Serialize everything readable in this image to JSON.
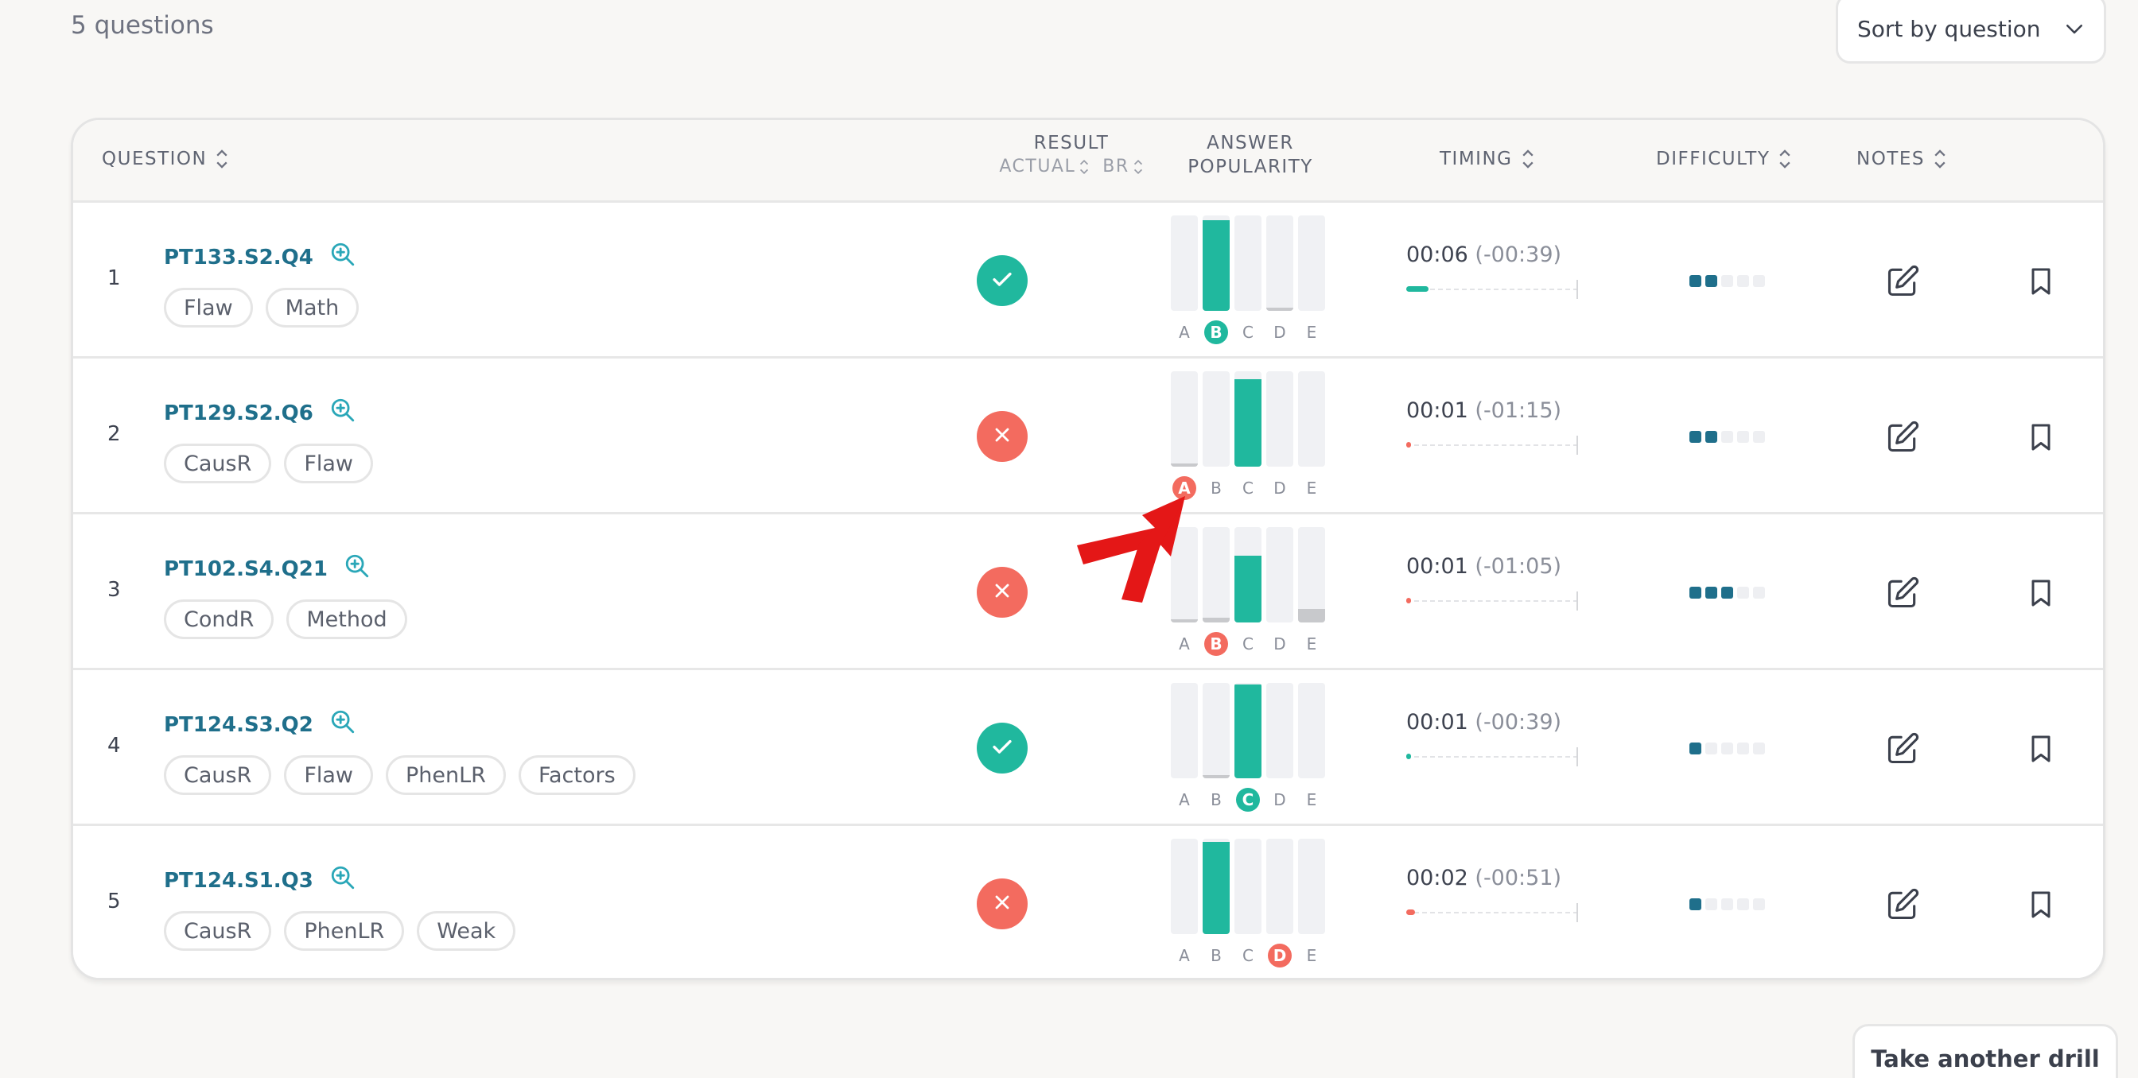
{
  "header": {
    "count_text": "5 questions",
    "sort_label": "Sort by question"
  },
  "columns": {
    "question": "QUESTION",
    "result": "RESULT",
    "actual": "ACTUAL",
    "br": "BR",
    "popularity_1": "ANSWER",
    "popularity_2": "POPULARITY",
    "timing": "TIMING",
    "difficulty": "DIFFICULTY",
    "notes": "NOTES"
  },
  "letters": [
    "A",
    "B",
    "C",
    "D",
    "E"
  ],
  "colors": {
    "correct": "#20b89e",
    "incorrect": "#f36b5f",
    "accent": "#1f6f8b",
    "neutral_fill": "#c8c9cc"
  },
  "rows": [
    {
      "num": "1",
      "id": "PT133.S2.Q4",
      "tags": [
        "Flaw",
        "Math"
      ],
      "result": "correct",
      "selected": "B",
      "selected_state": "correct",
      "popularity": [
        0,
        0.95,
        0,
        0.03,
        0
      ],
      "popular_correct": "B",
      "time": "00:06",
      "delta": "(-00:39)",
      "time_fraction": 0.13,
      "time_state": "ok",
      "difficulty": 2
    },
    {
      "num": "2",
      "id": "PT129.S2.Q6",
      "tags": [
        "CausR",
        "Flaw"
      ],
      "result": "incorrect",
      "selected": "A",
      "selected_state": "incorrect",
      "popularity": [
        0.03,
        0,
        0.92,
        0,
        0
      ],
      "popular_correct": "C",
      "time": "00:01",
      "delta": "(-01:15)",
      "time_fraction": 0.02,
      "time_state": "bad",
      "difficulty": 2
    },
    {
      "num": "3",
      "id": "PT102.S4.Q21",
      "tags": [
        "CondR",
        "Method"
      ],
      "result": "incorrect",
      "selected": "B",
      "selected_state": "incorrect",
      "popularity": [
        0.03,
        0.05,
        0.7,
        0,
        0.14
      ],
      "popular_correct": "C",
      "time": "00:01",
      "delta": "(-01:05)",
      "time_fraction": 0.02,
      "time_state": "bad",
      "difficulty": 3
    },
    {
      "num": "4",
      "id": "PT124.S3.Q2",
      "tags": [
        "CausR",
        "Flaw",
        "PhenLR",
        "Factors"
      ],
      "result": "correct",
      "selected": "C",
      "selected_state": "correct",
      "popularity": [
        0,
        0.02,
        0.98,
        0,
        0
      ],
      "popular_correct": "C",
      "time": "00:01",
      "delta": "(-00:39)",
      "time_fraction": 0.02,
      "time_state": "ok",
      "difficulty": 1
    },
    {
      "num": "5",
      "id": "PT124.S1.Q3",
      "tags": [
        "CausR",
        "PhenLR",
        "Weak"
      ],
      "result": "incorrect",
      "selected": "D",
      "selected_state": "incorrect",
      "popularity": [
        0,
        0.97,
        0,
        0,
        0
      ],
      "popular_correct": "B",
      "time": "00:02",
      "delta": "(-00:51)",
      "time_fraction": 0.05,
      "time_state": "bad",
      "difficulty": 1
    }
  ],
  "footer": {
    "take_drill_label": "Take another drill"
  }
}
